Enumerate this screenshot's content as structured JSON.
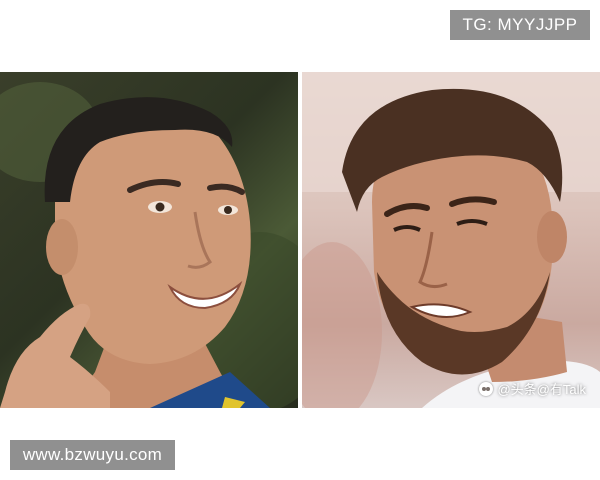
{
  "top_label": {
    "text": "TG: MYYJJPP"
  },
  "photos": {
    "left": {
      "icon": "portrait-photo"
    },
    "right": {
      "icon": "portrait-photo"
    }
  },
  "watermark": {
    "text": "@头条@有Talk",
    "icon": "paw-icon"
  },
  "bottom_label": {
    "text": "www.bzwuyu.com"
  },
  "colors": {
    "label_background": "#909090",
    "label_text": "#ffffff",
    "page_background": "#ffffff"
  }
}
